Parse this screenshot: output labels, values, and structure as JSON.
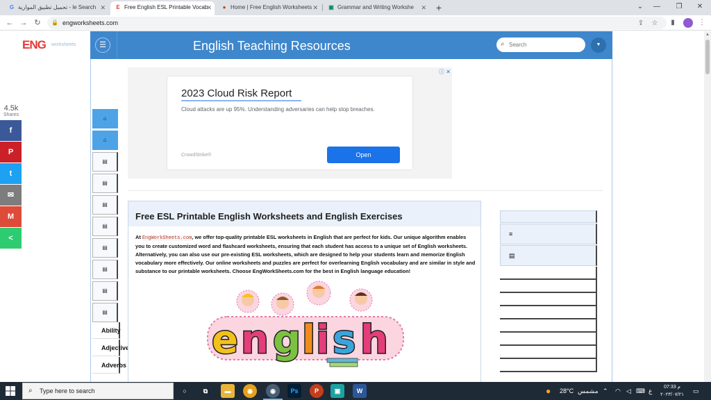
{
  "browser": {
    "tabs": [
      {
        "title": "تحميل تطبيق الموارية - le Search",
        "icon": "google-icon",
        "active": false
      },
      {
        "title": "Free English ESL Printable Vocab",
        "icon": "eng-favicon-icon",
        "active": true
      },
      {
        "title": "Home | Free English Worksheets",
        "icon": "site-favicon-icon",
        "active": false
      },
      {
        "title": "Grammar and Writing Workshe",
        "icon": "grammar-favicon-icon",
        "active": false
      }
    ],
    "close_glyph": "✕",
    "new_tab_glyph": "+",
    "url": "engworksheets.com"
  },
  "site": {
    "logo_text": "ENG",
    "logo_sub": "worksheets",
    "title": "English Teaching Resources",
    "search_placeholder": "Search",
    "menu_glyph": "☰",
    "dropdown_glyph": "▼"
  },
  "share": {
    "count": "4.5k",
    "label": "Shares",
    "buttons": [
      {
        "name": "facebook",
        "glyph": "f",
        "color": "#3b5998"
      },
      {
        "name": "pinterest",
        "glyph": "P",
        "color": "#cb2027"
      },
      {
        "name": "twitter",
        "glyph": "t",
        "color": "#1da1f2"
      },
      {
        "name": "email",
        "glyph": "✉",
        "color": "#7d7d7d"
      },
      {
        "name": "gmail",
        "glyph": "M",
        "color": "#dd4b39"
      },
      {
        "name": "sharethis",
        "glyph": "<",
        "color": "#2ecc71"
      }
    ]
  },
  "left_menu": {
    "icons": [
      "home",
      "home",
      "doc",
      "doc",
      "doc",
      "doc",
      "doc",
      "doc",
      "doc",
      "doc"
    ],
    "text_items": [
      "Ability",
      "Adjectives",
      "Adverbs"
    ]
  },
  "ad": {
    "title": "2023 Cloud Risk Report",
    "text": "Cloud attacks are up 95%. Understanding adversaries can help stop breaches.",
    "brand": "CrowdStrike®",
    "button": "Open",
    "choices": "ⓘ ✕"
  },
  "article": {
    "title": "Free ESL Printable English Worksheets and English Exercises",
    "intro": "At ",
    "site_name": "EngWorkSheets.com",
    "body": ", we offer top-quality printable ESL worksheets in English that are perfect for kids. Our unique algorithm enables you to create customized word and flashcard worksheets, ensuring that each student has access to a unique set of English worksheets. Alternatively, you can also use our pre-existing ESL worksheets, which are designed to help your students learn and memorize English vocabulary more effectively. Our online worksheets and puzzles are perfect for overlearning English vocabulary and are similar in style and substance to our printable worksheets. Choose EngWorkSheets.com for the best in English language education!",
    "art_word": "english"
  },
  "right_sidebar": {
    "rows": [
      "",
      "≡",
      "📄"
    ],
    "empty_lines": 8
  },
  "taskbar": {
    "search_text": "Type here to search",
    "weather": "28°C",
    "weather_label": "مشمس",
    "time": "07:33 م",
    "date": "٢٠٢٣/٠٧/٢١",
    "lang": "ع"
  },
  "colors": {
    "header_blue": "#3e87cc",
    "logo_red": "#e53935",
    "menu_blue": "#4da3e6",
    "ad_button": "#1a73e8"
  }
}
